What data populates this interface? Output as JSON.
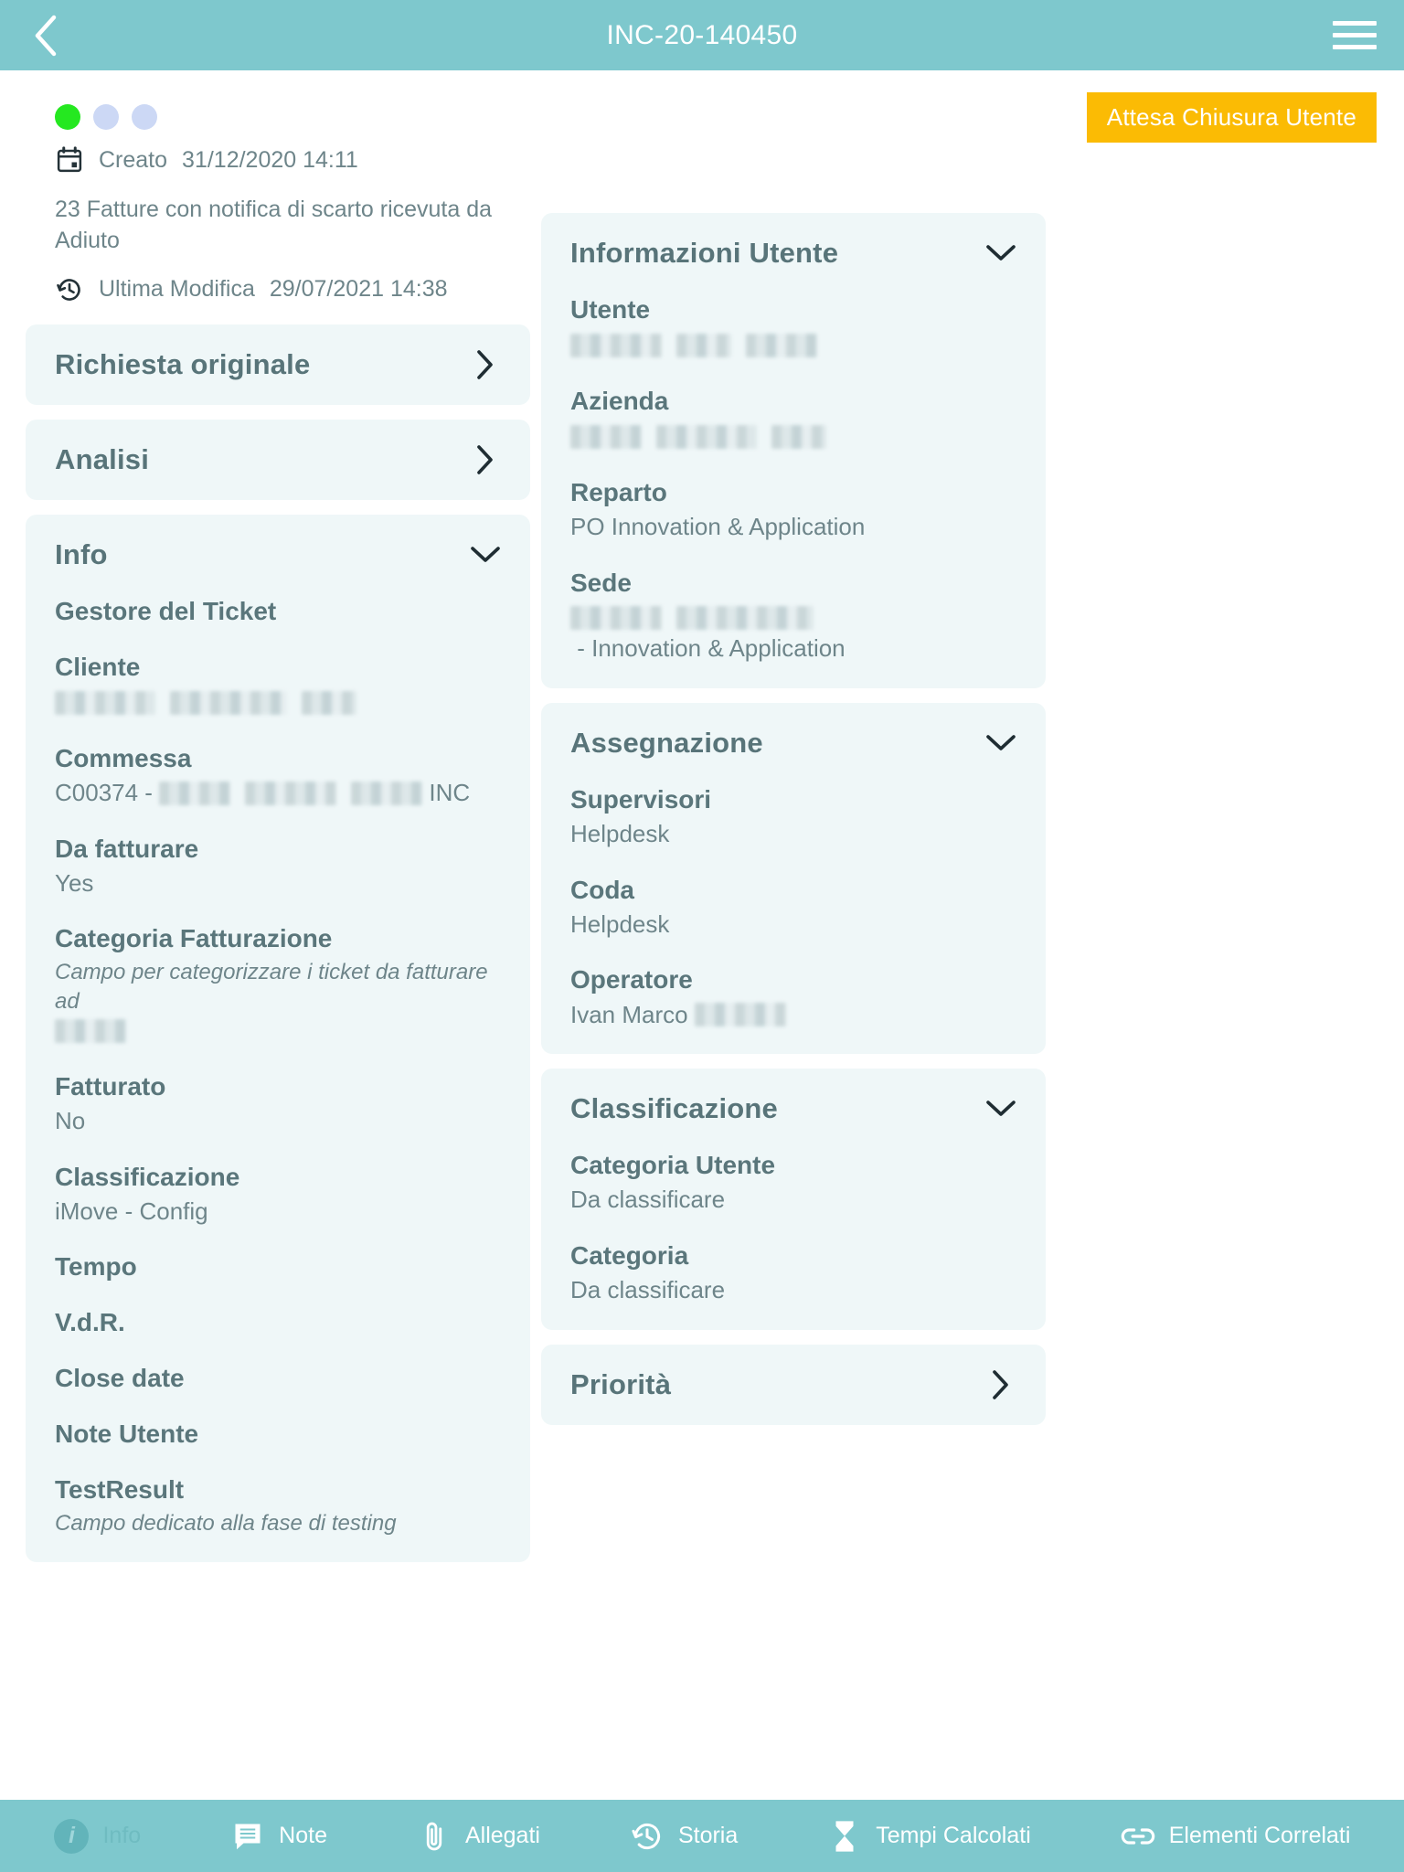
{
  "header": {
    "title": "INC-20-140450",
    "back_icon": "chevron-left-icon",
    "menu_icon": "hamburger-menu-icon"
  },
  "status": {
    "dots": [
      "green",
      "inactive",
      "inactive"
    ],
    "badge_label": "Attesa Chiusura Utente",
    "badge_color": "#fbbb04",
    "active_dot_color": "#25e820",
    "inactive_dot_color": "#ccd8f5"
  },
  "meta": {
    "created_label": "Creato",
    "created_value": "31/12/2020 14:11",
    "description": "23 Fatture con notifica di scarto ricevuta da Adiuto",
    "modified_label": "Ultima Modifica",
    "modified_value": "29/07/2021 14:38",
    "calendar_icon": "calendar-icon",
    "history_icon": "history-icon"
  },
  "left_column": {
    "richiesta_originale": {
      "title": "Richiesta originale",
      "chevron": "chevron-right-icon"
    },
    "analisi": {
      "title": "Analisi",
      "chevron": "chevron-right-icon"
    },
    "info": {
      "title": "Info",
      "chevron": "chevron-down-icon",
      "fields": [
        {
          "label": "Gestore del Ticket",
          "value": ""
        },
        {
          "label": "Cliente",
          "value": "[redacted]"
        },
        {
          "label": "Commessa",
          "value": "C00374 - [redacted] INC"
        },
        {
          "label": "Da fatturare",
          "value": "Yes"
        },
        {
          "label": "Categoria Fatturazione",
          "value": "Campo per categorizzare i ticket da fatturare ad [redacted]"
        },
        {
          "label": "Fatturato",
          "value": "No"
        },
        {
          "label": "Classificazione",
          "value": "iMove - Config"
        },
        {
          "label": "Tempo",
          "value": ""
        },
        {
          "label": "V.d.R.",
          "value": ""
        },
        {
          "label": "Close date",
          "value": ""
        },
        {
          "label": "Note Utente",
          "value": ""
        },
        {
          "label": "TestResult",
          "value": "Campo dedicato alla fase di testing"
        }
      ]
    }
  },
  "right_column": {
    "informazioni_utente": {
      "title": "Informazioni Utente",
      "chevron": "chevron-down-icon",
      "fields": [
        {
          "label": "Utente",
          "value": "[redacted]"
        },
        {
          "label": "Azienda",
          "value": "[redacted]"
        },
        {
          "label": "Reparto",
          "value": "PO Innovation & Application"
        },
        {
          "label": "Sede",
          "value": "[redacted] - Innovation & Application"
        }
      ]
    },
    "assegnazione": {
      "title": "Assegnazione",
      "chevron": "chevron-down-icon",
      "fields": [
        {
          "label": "Supervisori",
          "value": "Helpdesk"
        },
        {
          "label": "Coda",
          "value": "Helpdesk"
        },
        {
          "label": "Operatore",
          "value": "Ivan Marco [redacted]"
        }
      ]
    },
    "classificazione": {
      "title": "Classificazione",
      "chevron": "chevron-down-icon",
      "fields": [
        {
          "label": "Categoria Utente",
          "value": "Da classificare"
        },
        {
          "label": "Categoria",
          "value": "Da classificare"
        }
      ]
    },
    "priorita": {
      "title": "Priorità",
      "chevron": "chevron-right-icon"
    }
  },
  "tabbar": {
    "items": [
      {
        "label": "Info",
        "icon": "info-circle-icon",
        "active": true
      },
      {
        "label": "Note",
        "icon": "note-icon",
        "active": false
      },
      {
        "label": "Allegati",
        "icon": "paperclip-icon",
        "active": false
      },
      {
        "label": "Storia",
        "icon": "history-icon",
        "active": false
      },
      {
        "label": "Tempi Calcolati",
        "icon": "hourglass-icon",
        "active": false
      },
      {
        "label": "Elementi Correlati",
        "icon": "link-icon",
        "active": false
      }
    ]
  },
  "theme": {
    "accent": "#7ec8cd",
    "card_bg": "#eff7f8",
    "text": "#5a767b"
  }
}
